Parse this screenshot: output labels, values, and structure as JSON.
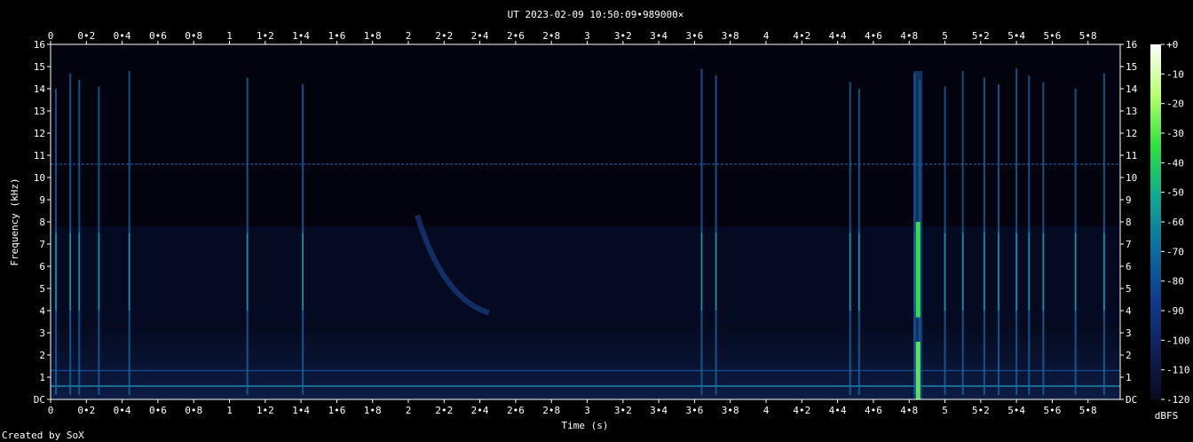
{
  "chart_data": {
    "type": "heatmap",
    "title": "UT 2023-02-09 10:50:09•989000×",
    "xlabel": "Time (s)",
    "ylabel": "Frequency (kHz)",
    "xlim": [
      0,
      5.98
    ],
    "ylim": [
      0,
      16
    ],
    "x_ticks": [
      "0",
      "0•2",
      "0•4",
      "0•6",
      "0•8",
      "1",
      "1•2",
      "1•4",
      "1•6",
      "1•8",
      "2",
      "2•2",
      "2•4",
      "2•6",
      "2•8",
      "3",
      "3•2",
      "3•4",
      "3•6",
      "3•8",
      "4",
      "4•2",
      "4•4",
      "4•6",
      "4•8",
      "5",
      "5•2",
      "5•4",
      "5•6",
      "5•8"
    ],
    "x_tick_values": [
      0,
      0.2,
      0.4,
      0.6,
      0.8,
      1,
      1.2,
      1.4,
      1.6,
      1.8,
      2,
      2.2,
      2.4,
      2.6,
      2.8,
      3,
      3.2,
      3.4,
      3.6,
      3.8,
      4,
      4.2,
      4.4,
      4.6,
      4.8,
      5,
      5.2,
      5.4,
      5.6,
      5.8
    ],
    "y_ticks": [
      "DC",
      "1",
      "2",
      "3",
      "4",
      "5",
      "6",
      "7",
      "8",
      "9",
      "10",
      "11",
      "12",
      "13",
      "14",
      "15",
      "16"
    ],
    "y_tick_values": [
      0,
      1,
      2,
      3,
      4,
      5,
      6,
      7,
      8,
      9,
      10,
      11,
      12,
      13,
      14,
      15,
      16
    ],
    "colorbar": {
      "label": "dBFS",
      "ticks": [
        "+0",
        "-10",
        "-20",
        "-30",
        "-40",
        "-50",
        "-60",
        "-70",
        "-80",
        "-90",
        "-100",
        "-110",
        "-120"
      ],
      "range": [
        -120,
        0
      ],
      "colors": [
        "#0a0a1e",
        "#10205a",
        "#103c8c",
        "#0e6ea0",
        "#12a890",
        "#30e040",
        "#b8ff70",
        "#ffffff"
      ]
    },
    "features": {
      "tones_khz": [
        0.6,
        1.3,
        10.6
      ],
      "wideband_impulses_s": [
        0.03,
        0.11,
        0.16,
        0.27,
        0.44,
        1.1,
        1.41,
        3.64,
        3.72,
        4.47,
        4.52,
        4.83,
        4.86,
        5.0,
        5.1,
        5.22,
        5.3,
        5.4,
        5.47,
        5.55,
        5.73,
        5.89
      ],
      "strong_impulse_s": [
        4.85
      ],
      "sweep": {
        "start_s": 2.05,
        "end_s": 2.45,
        "start_khz": 8.3,
        "end_khz": 3.9
      }
    }
  },
  "footer": {
    "credit": "Created by SoX"
  }
}
